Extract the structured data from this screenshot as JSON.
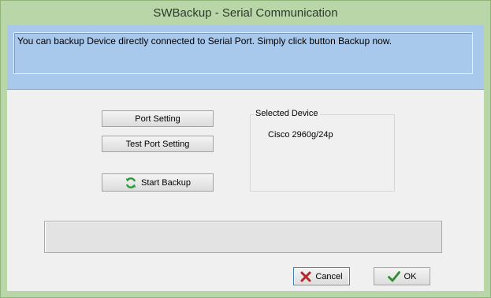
{
  "window": {
    "title": "SWBackup - Serial Communication"
  },
  "banner": {
    "message": "You can backup Device directly connected to Serial Port. Simply click button Backup now."
  },
  "buttons": {
    "port_setting": "Port Setting",
    "test_port_setting": "Test Port Setting",
    "start_backup": "Start Backup",
    "cancel": "Cancel",
    "ok": "OK"
  },
  "selected_device": {
    "title": "Selected Device",
    "name": "Cisco 2960g/24p"
  },
  "status": {
    "text": ""
  },
  "icons": {
    "start_backup": "refresh-icon",
    "cancel": "x-icon",
    "ok": "checkmark-icon"
  },
  "colors": {
    "frame": "#b9d6a9",
    "banner": "#a8c8ec",
    "client": "#f0f0f0",
    "cancel_icon": "#b5262a",
    "ok_icon": "#2f8f2f",
    "refresh_icon": "#2f9a3a"
  }
}
